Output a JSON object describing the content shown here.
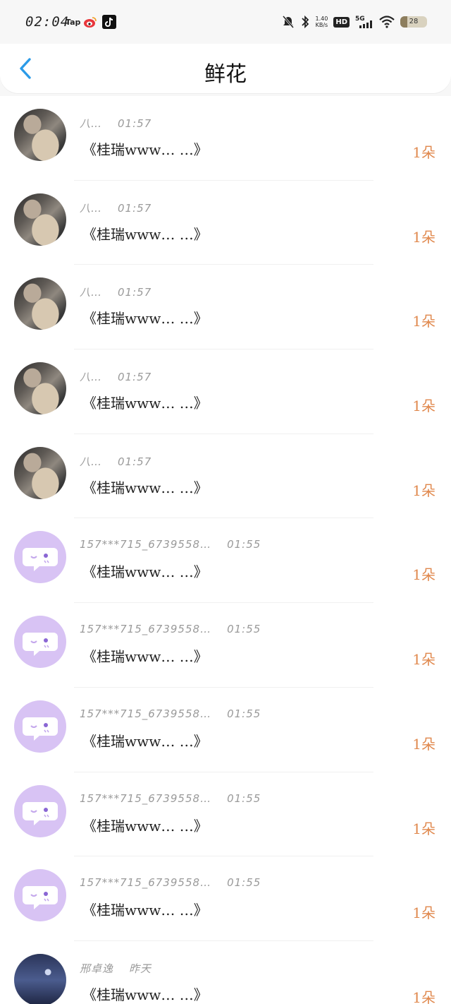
{
  "status_bar": {
    "time": "02:04",
    "app_icons": [
      "Tap",
      "weibo-icon",
      "tiktok-icon"
    ],
    "net_speed_top": "1.40",
    "net_speed_bottom": "KB/s",
    "hd": "HD",
    "network": "5G",
    "battery": "28"
  },
  "header": {
    "title": "鲜花",
    "back_icon": "chevron-left-icon"
  },
  "colors": {
    "accent_blue": "#2b9be8",
    "count_orange": "#e0884d",
    "bot_avatar_purple": "#d8c3f4"
  },
  "items": [
    {
      "avatar": "photo",
      "name": "八…",
      "time": "01:57",
      "gift": "《桂瑞www… …》",
      "count": "1朵"
    },
    {
      "avatar": "photo",
      "name": "八…",
      "time": "01:57",
      "gift": "《桂瑞www… …》",
      "count": "1朵"
    },
    {
      "avatar": "photo",
      "name": "八…",
      "time": "01:57",
      "gift": "《桂瑞www… …》",
      "count": "1朵"
    },
    {
      "avatar": "photo",
      "name": "八…",
      "time": "01:57",
      "gift": "《桂瑞www… …》",
      "count": "1朵"
    },
    {
      "avatar": "photo",
      "name": "八…",
      "time": "01:57",
      "gift": "《桂瑞www… …》",
      "count": "1朵"
    },
    {
      "avatar": "bot",
      "name": "157***715_6739558…",
      "time": "01:55",
      "gift": "《桂瑞www… …》",
      "count": "1朵"
    },
    {
      "avatar": "bot",
      "name": "157***715_6739558…",
      "time": "01:55",
      "gift": "《桂瑞www… …》",
      "count": "1朵"
    },
    {
      "avatar": "bot",
      "name": "157***715_6739558…",
      "time": "01:55",
      "gift": "《桂瑞www… …》",
      "count": "1朵"
    },
    {
      "avatar": "bot",
      "name": "157***715_6739558…",
      "time": "01:55",
      "gift": "《桂瑞www… …》",
      "count": "1朵"
    },
    {
      "avatar": "bot",
      "name": "157***715_6739558…",
      "time": "01:55",
      "gift": "《桂瑞www… …》",
      "count": "1朵"
    },
    {
      "avatar": "night",
      "name": "邢卓逸",
      "time": "昨天",
      "gift": "《桂瑞www… …》",
      "count": "1朵"
    }
  ]
}
